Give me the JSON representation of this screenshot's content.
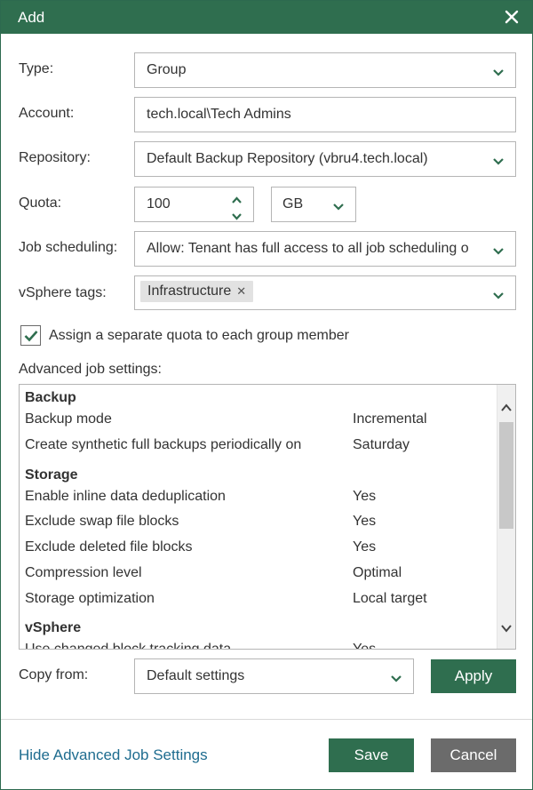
{
  "window": {
    "title": "Add",
    "close_icon": "close-icon"
  },
  "form": {
    "type_label": "Type:",
    "type_value": "Group",
    "account_label": "Account:",
    "account_value": "tech.local\\Tech Admins",
    "repository_label": "Repository:",
    "repository_value": "Default Backup Repository (vbru4.tech.local)",
    "quota_label": "Quota:",
    "quota_value": "100",
    "quota_unit": "GB",
    "job_scheduling_label": "Job scheduling:",
    "job_scheduling_value": "Allow: Tenant has full access to all job scheduling o",
    "vsphere_tags_label": "vSphere tags:",
    "vsphere_tags": [
      "Infrastructure"
    ],
    "separate_quota_checked": true,
    "separate_quota_label": "Assign a separate quota to each group member"
  },
  "advanced": {
    "label": "Advanced job settings:",
    "sections": [
      {
        "title": "Backup",
        "rows": [
          {
            "name": "Backup mode",
            "value": "Incremental"
          },
          {
            "name": "Create synthetic full backups periodically on",
            "value": "Saturday"
          }
        ]
      },
      {
        "title": "Storage",
        "rows": [
          {
            "name": "Enable inline data deduplication",
            "value": "Yes"
          },
          {
            "name": "Exclude swap file blocks",
            "value": "Yes"
          },
          {
            "name": "Exclude deleted file blocks",
            "value": "Yes"
          },
          {
            "name": "Compression level",
            "value": "Optimal"
          },
          {
            "name": "Storage optimization",
            "value": "Local target"
          }
        ]
      },
      {
        "title": "vSphere",
        "rows": [
          {
            "name": "Use changed block tracking data",
            "value": "Yes"
          }
        ]
      }
    ]
  },
  "copy": {
    "label": "Copy from:",
    "value": "Default settings",
    "apply_label": "Apply"
  },
  "footer": {
    "hide_link": "Hide Advanced Job Settings",
    "save_label": "Save",
    "cancel_label": "Cancel"
  },
  "colors": {
    "accent": "#2f6e4f",
    "link": "#1e6c8f",
    "cancel": "#6b6b6b"
  }
}
